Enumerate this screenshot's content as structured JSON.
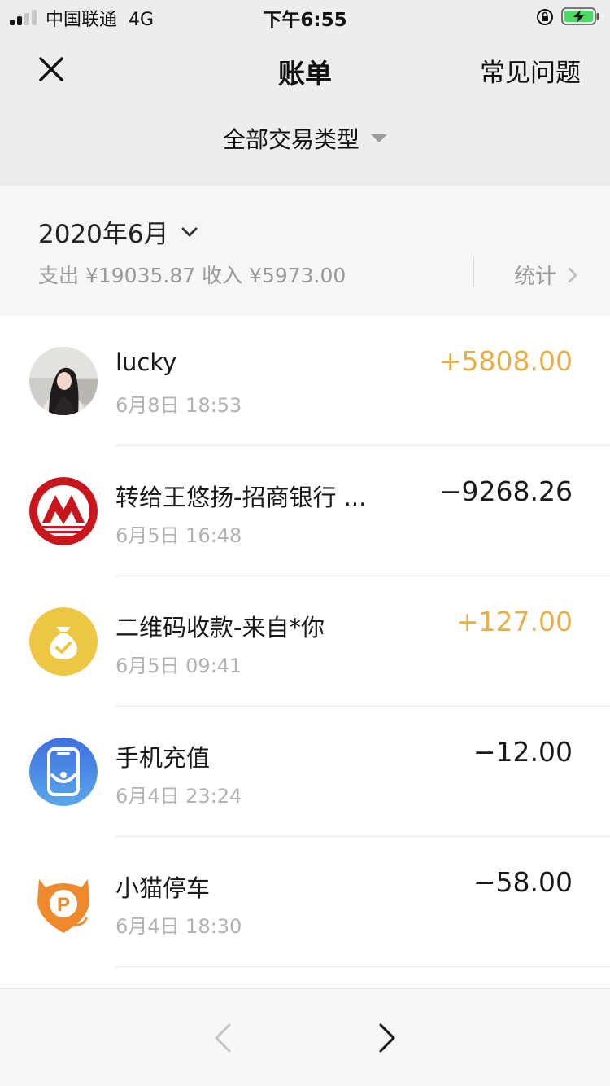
{
  "status_bar": {
    "carrier": "中国联通",
    "network": "4G",
    "time": "下午6:55",
    "signal_bars": 2
  },
  "nav": {
    "title": "账单",
    "faq_label": "常见问题"
  },
  "filter": {
    "label": "全部交易类型"
  },
  "summary": {
    "month": "2020年6月",
    "totals": "支出 ¥19035.87 收入 ¥5973.00",
    "stats_label": "统计"
  },
  "transactions": [
    {
      "title": "lucky",
      "time": "6月8日 18:53",
      "amount": "+5808.00",
      "type": "income",
      "icon": "user-photo-avatar"
    },
    {
      "title": "转给王悠扬-招商银行 ...",
      "time": "6月5日 16:48",
      "amount": "−9268.26",
      "type": "expense",
      "icon": "cmb-bank-icon"
    },
    {
      "title": "二维码收款-来自*你",
      "time": "6月5日 09:41",
      "amount": "+127.00",
      "type": "income",
      "icon": "money-bag-icon"
    },
    {
      "title": "手机充值",
      "time": "6月4日 23:24",
      "amount": "−12.00",
      "type": "expense",
      "icon": "phone-recharge-icon"
    },
    {
      "title": "小猫停车",
      "time": "6月4日 18:30",
      "amount": "−58.00",
      "type": "expense",
      "icon": "parking-icon"
    }
  ],
  "colors": {
    "income": "#e5b04c",
    "expense": "#1a1a1a",
    "background": "#ededed"
  }
}
